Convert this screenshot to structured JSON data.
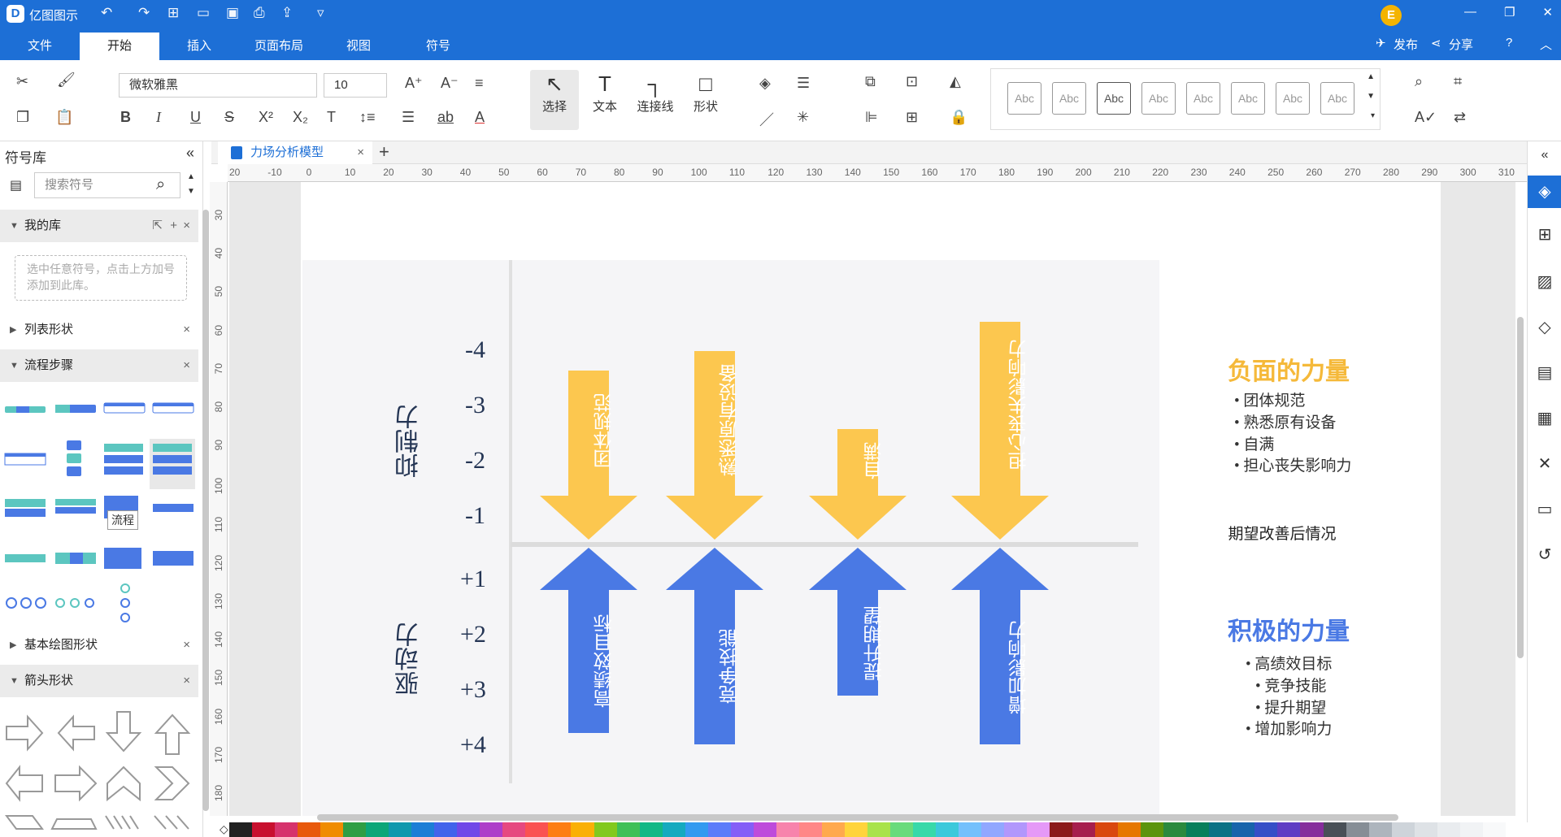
{
  "app": {
    "name": "亿图图示",
    "logo": "D"
  },
  "menus": [
    "文件",
    "开始",
    "插入",
    "页面布局",
    "视图",
    "符号"
  ],
  "top_right": {
    "avatar": "E",
    "publish": "发布",
    "share": "分享"
  },
  "ribbon": {
    "font_name": "微软雅黑",
    "font_size": "10",
    "tools": {
      "select": "选择",
      "text": "文本",
      "connector": "连接线",
      "shape": "形状"
    },
    "style_samples": [
      "Abc",
      "Abc",
      "Abc",
      "Abc",
      "Abc",
      "Abc",
      "Abc",
      "Abc"
    ]
  },
  "sidebar": {
    "title": "符号库",
    "search_placeholder": "搜索符号",
    "groups": {
      "my_lib": "我的库",
      "my_lib_hint": "选中任意符号，点击上方加号添加到此库。",
      "list_shapes": "列表形状",
      "flow_steps": "流程步骤",
      "flow_tooltip": "流程",
      "basic_shapes": "基本绘图形状",
      "arrow_shapes": "箭头形状"
    }
  },
  "document": {
    "tab_title": "力场分析模型"
  },
  "ruler": {
    "h_ticks": [
      "20",
      "-10",
      "0",
      "10",
      "20",
      "30",
      "40",
      "50",
      "60",
      "70",
      "80",
      "90",
      "100",
      "110",
      "120",
      "130",
      "140",
      "150",
      "160",
      "170",
      "180",
      "190",
      "200",
      "210",
      "220",
      "230",
      "240",
      "250",
      "260",
      "270",
      "280",
      "290",
      "300",
      "310"
    ],
    "v_ticks": [
      "30",
      "40",
      "50",
      "60",
      "70",
      "80",
      "90",
      "100",
      "110",
      "120",
      "130",
      "140",
      "150",
      "160",
      "170",
      "180"
    ]
  },
  "diagram": {
    "restraining_label": "抑制力",
    "driving_label": "驱动力",
    "neg_scale": [
      "-4",
      "-3",
      "-2",
      "-1"
    ],
    "pos_scale": [
      "+1",
      "+2",
      "+3",
      "+4"
    ],
    "negative_forces": [
      "团体规范",
      "熟悉原有设备",
      "自满",
      "担心丧失影响力"
    ],
    "positive_forces": [
      "高绩效目标",
      "竞争技能",
      "提升期望",
      "增加影响力"
    ],
    "negative_color": "#fcc74f",
    "positive_color": "#4a79e4",
    "neg_title": "负面的力量",
    "neg_items": [
      "团体规范",
      "熟悉原有设备",
      "自满",
      "担心丧失影响力"
    ],
    "mid_label": "期望改善后情况",
    "pos_title": "积极的力量",
    "pos_items": [
      "高绩效目标",
      "竞争技能",
      "提升期望",
      "增加影响力"
    ],
    "neg_title_color": "#f5b93a",
    "pos_title_color": "#4a79e4"
  }
}
